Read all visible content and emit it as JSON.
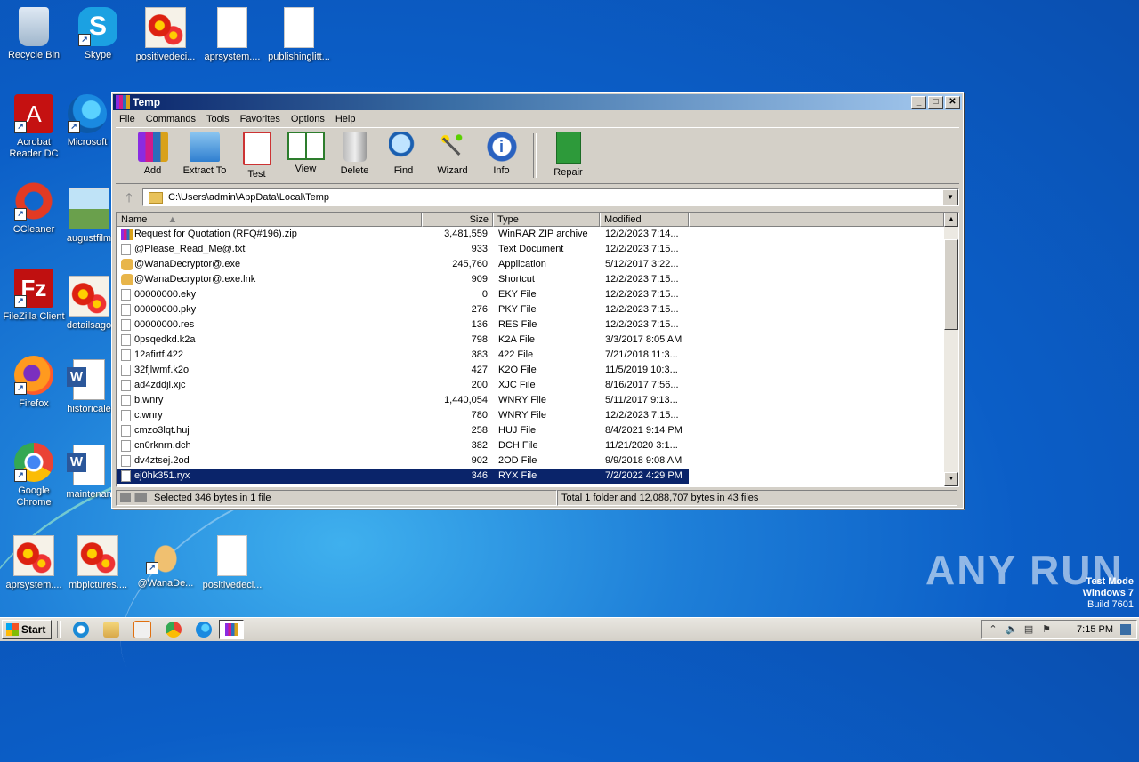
{
  "desktop": {
    "icons": [
      {
        "label": "Recycle Bin"
      },
      {
        "label": "Skype"
      },
      {
        "label": "positivedeci..."
      },
      {
        "label": "aprsystem...."
      },
      {
        "label": "publishinglitt..."
      },
      {
        "label": "Acrobat Reader DC"
      },
      {
        "label": "Microsoft"
      },
      {
        "label": "CCleaner"
      },
      {
        "label": "augustfilm"
      },
      {
        "label": "FileZilla Client"
      },
      {
        "label": "detailsago"
      },
      {
        "label": "Firefox"
      },
      {
        "label": "historicale"
      },
      {
        "label": "Google Chrome"
      },
      {
        "label": "maintenan"
      },
      {
        "label": "aprsystem...."
      },
      {
        "label": "mbpictures...."
      },
      {
        "label": "@WanaDe..."
      },
      {
        "label": "positivedeci..."
      }
    ]
  },
  "window": {
    "title": "Temp",
    "controls": {
      "minimize": "_",
      "maximize": "□",
      "close": "✕"
    },
    "menu": [
      "File",
      "Commands",
      "Tools",
      "Favorites",
      "Options",
      "Help"
    ],
    "toolbar": [
      "Add",
      "Extract To",
      "Test",
      "View",
      "Delete",
      "Find",
      "Wizard",
      "Info",
      "Repair"
    ],
    "address": "C:\\Users\\admin\\AppData\\Local\\Temp",
    "up_arrow": "🡑",
    "columns": {
      "name": "Name",
      "size": "Size",
      "type": "Type",
      "modified": "Modified"
    },
    "files": [
      {
        "name": "Request for Quotation (RFQ#196).zip",
        "size": "3,481,559",
        "type": "WinRAR ZIP archive",
        "modified": "12/2/2023 7:14...",
        "icon": "zip"
      },
      {
        "name": "@Please_Read_Me@.txt",
        "size": "933",
        "type": "Text Document",
        "modified": "12/2/2023 7:15...",
        "icon": "doc"
      },
      {
        "name": "@WanaDecryptor@.exe",
        "size": "245,760",
        "type": "Application",
        "modified": "5/12/2017 3:22...",
        "icon": "hand"
      },
      {
        "name": "@WanaDecryptor@.exe.lnk",
        "size": "909",
        "type": "Shortcut",
        "modified": "12/2/2023 7:15...",
        "icon": "hand"
      },
      {
        "name": "00000000.eky",
        "size": "0",
        "type": "EKY File",
        "modified": "12/2/2023 7:15...",
        "icon": "doc"
      },
      {
        "name": "00000000.pky",
        "size": "276",
        "type": "PKY File",
        "modified": "12/2/2023 7:15...",
        "icon": "doc"
      },
      {
        "name": "00000000.res",
        "size": "136",
        "type": "RES File",
        "modified": "12/2/2023 7:15...",
        "icon": "doc"
      },
      {
        "name": "0psqedkd.k2a",
        "size": "798",
        "type": "K2A File",
        "modified": "3/3/2017 8:05 AM",
        "icon": "doc"
      },
      {
        "name": "12afirtf.422",
        "size": "383",
        "type": "422 File",
        "modified": "7/21/2018 11:3...",
        "icon": "doc"
      },
      {
        "name": "32fjlwmf.k2o",
        "size": "427",
        "type": "K2O File",
        "modified": "11/5/2019 10:3...",
        "icon": "doc"
      },
      {
        "name": "ad4zddjl.xjc",
        "size": "200",
        "type": "XJC File",
        "modified": "8/16/2017 7:56...",
        "icon": "doc"
      },
      {
        "name": "b.wnry",
        "size": "1,440,054",
        "type": "WNRY File",
        "modified": "5/11/2017 9:13...",
        "icon": "doc"
      },
      {
        "name": "c.wnry",
        "size": "780",
        "type": "WNRY File",
        "modified": "12/2/2023 7:15...",
        "icon": "doc"
      },
      {
        "name": "cmzo3lqt.huj",
        "size": "258",
        "type": "HUJ File",
        "modified": "8/4/2021 9:14 PM",
        "icon": "doc"
      },
      {
        "name": "cn0rknrn.dch",
        "size": "382",
        "type": "DCH File",
        "modified": "11/21/2020 3:1...",
        "icon": "doc"
      },
      {
        "name": "dv4ztsej.2od",
        "size": "902",
        "type": "2OD File",
        "modified": "9/9/2018 9:08 AM",
        "icon": "doc"
      },
      {
        "name": "ej0hk351.ryx",
        "size": "346",
        "type": "RYX File",
        "modified": "7/2/2022 4:29 PM",
        "icon": "doc",
        "selected": true
      }
    ],
    "status_left": "Selected 346 bytes in 1 file",
    "status_right": "Total 1 folder and 12,088,707 bytes in 43 files"
  },
  "taskbar": {
    "start": "Start",
    "clock": "7:15 PM"
  },
  "watermark": {
    "test_mode": "Test Mode",
    "os": "Windows 7",
    "build": "Build 7601",
    "brand": "ANY RUN"
  }
}
